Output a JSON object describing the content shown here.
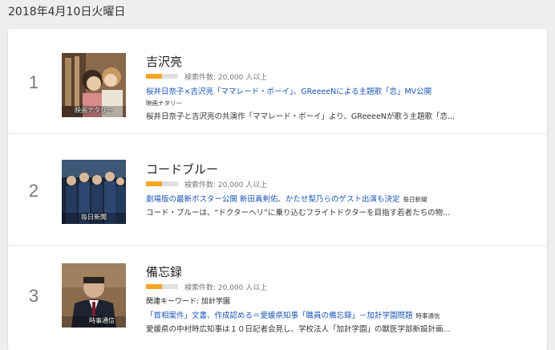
{
  "date_heading": "2018年4月10日火曜日",
  "trends": [
    {
      "rank": "1",
      "title": "吉沢亮",
      "volume_text": "検索件数: 20,000 人以上",
      "volume_fraction": 0.5,
      "related": "",
      "headline": "桜井日奈子×吉沢亮「ママレード・ボーイ」、GReeeeNによる主題歌「恋」MV公開",
      "source": "映画ナタリー",
      "snippet": "桜井日奈子と吉沢亮の共演作「ママレード・ボーイ」より、GReeeeNが歌う主題歌「恋...",
      "thumb_caption": "映画ナタリー",
      "thumb_colors": [
        "#7a5a3a",
        "#c9a27a",
        "#4a3322"
      ]
    },
    {
      "rank": "2",
      "title": "コードブルー",
      "volume_text": "検索件数: 20,000 人以上",
      "volume_fraction": 0.5,
      "related": "",
      "headline": "劇場版の最新ポスター公開 新田真剣佑、かたせ梨乃らのゲスト出演も決定",
      "source": "毎日新聞",
      "snippet": "コード・ブルーは、“ドクターヘリ”に乗り込むフライトドクターを目指す若者たちの物...",
      "thumb_caption": "毎日新聞",
      "thumb_colors": [
        "#1d2a44",
        "#3d5a80",
        "#0f1626"
      ]
    },
    {
      "rank": "3",
      "title": "備忘録",
      "volume_text": "検索件数: 20,000 人以上",
      "volume_fraction": 0.5,
      "related": "関連キーワード: 加計学園",
      "headline": "「首相案件」文書、作成認める＝愛媛県知事「職員の備忘録」－加計学園問題",
      "source": "時事通信",
      "snippet": "愛媛県の中村時広知事は１０日記者会見し、学校法人「加計学園」の獣医学部新設計画...",
      "thumb_caption": "時事通信",
      "thumb_colors": [
        "#8a6a4a",
        "#2a2a35",
        "#d9c4a8"
      ]
    }
  ]
}
